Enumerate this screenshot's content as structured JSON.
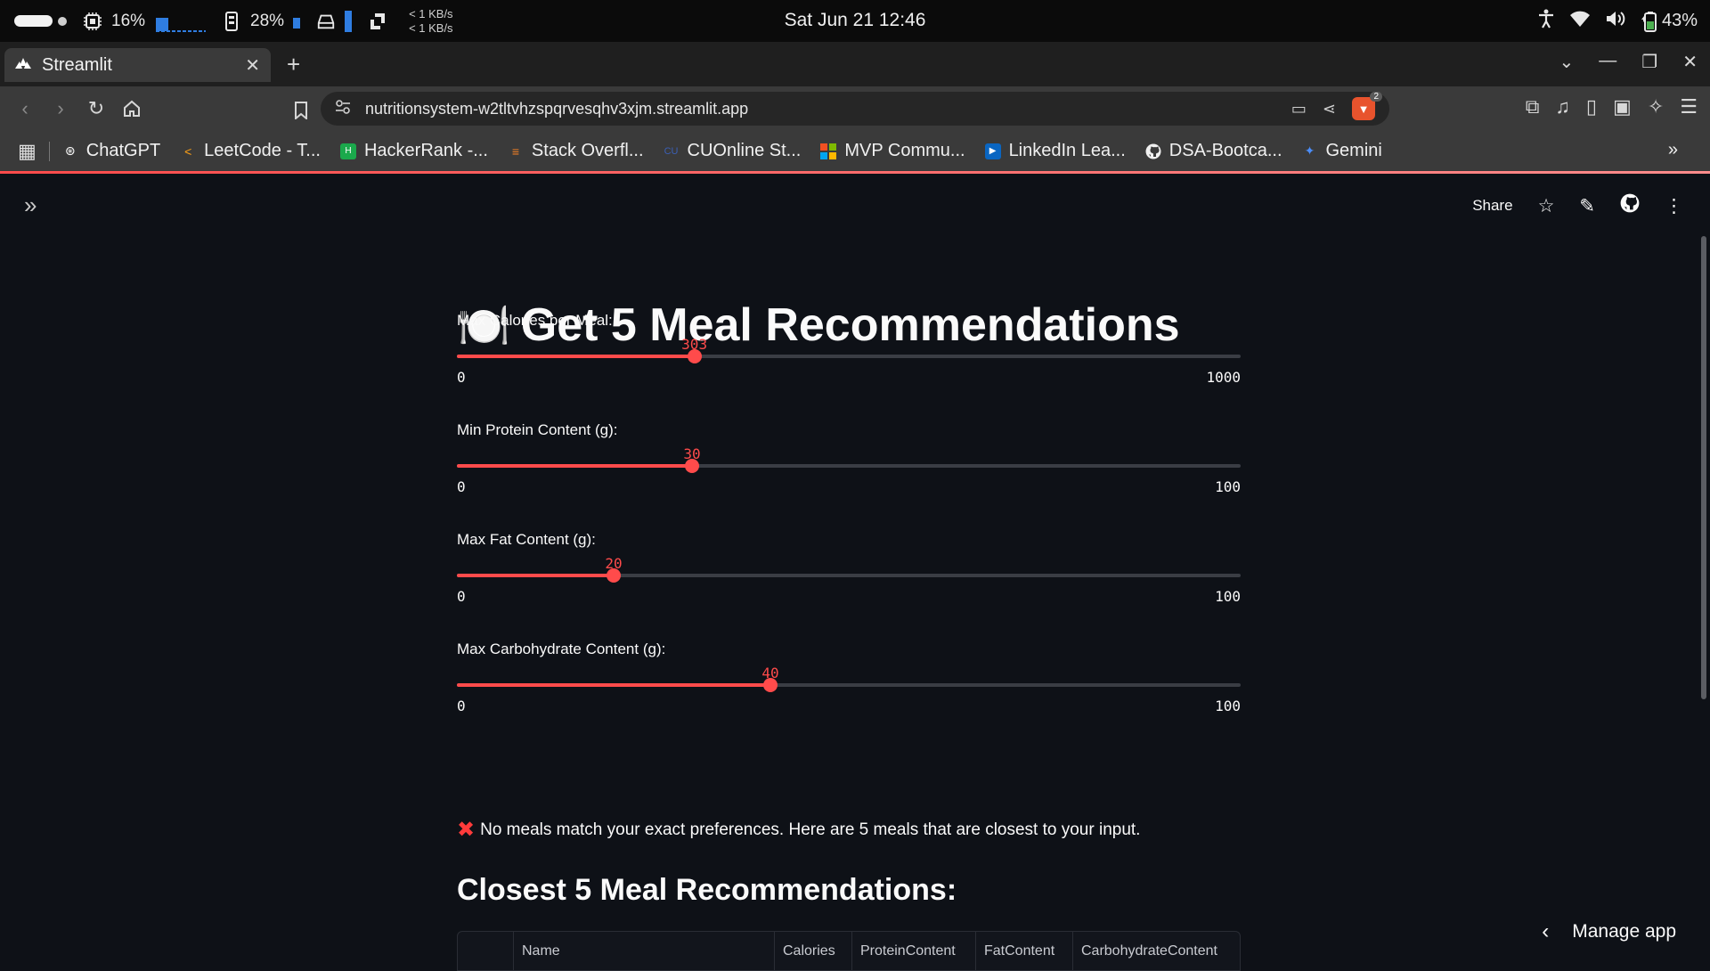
{
  "os": {
    "cpu": "16%",
    "mem": "28%",
    "net_down": "< 1 KB/s",
    "net_up": "< 1 KB/s",
    "clock": "Sat Jun 21  12:46",
    "battery": "43%",
    "icons": [
      "cpu-icon",
      "memory-icon",
      "disk-icon",
      "network-icon",
      "accessibility-icon",
      "wifi-icon",
      "volume-icon",
      "battery-icon"
    ]
  },
  "browser": {
    "tab_title": "Streamlit",
    "url": "nutritionsystem-w2tltvhzspqrvesqhv3xjm.streamlit.app",
    "brave_badge": "2",
    "bookmarks": [
      {
        "label": "ChatGPT",
        "icon": "chatgpt-icon"
      },
      {
        "label": "LeetCode - T...",
        "icon": "leetcode-icon"
      },
      {
        "label": "HackerRank -...",
        "icon": "hackerrank-icon"
      },
      {
        "label": "Stack Overfl...",
        "icon": "stackoverflow-icon"
      },
      {
        "label": "CUOnline St...",
        "icon": "cuonline-icon"
      },
      {
        "label": "MVP Commu...",
        "icon": "microsoft-icon"
      },
      {
        "label": "LinkedIn Lea...",
        "icon": "linkedin-learning-icon"
      },
      {
        "label": "DSA-Bootca...",
        "icon": "github-icon"
      },
      {
        "label": "Gemini",
        "icon": "gemini-icon"
      }
    ]
  },
  "app": {
    "share_label": "Share",
    "title": "Get 5 Meal Recommendations",
    "title_emoji": "🍽️",
    "sliders": [
      {
        "label": "Max Calories per Meal:",
        "value": 303,
        "min": 0,
        "max": 1000
      },
      {
        "label": "Min Protein Content (g):",
        "value": 30,
        "min": 0,
        "max": 100
      },
      {
        "label": "Max Fat Content (g):",
        "value": 20,
        "min": 0,
        "max": 100
      },
      {
        "label": "Max Carbohydrate Content (g):",
        "value": 40,
        "min": 0,
        "max": 100
      }
    ],
    "warning": "No meals match your exact preferences. Here are 5 meals that are closest to your input.",
    "subheading": "Closest 5 Meal Recommendations:",
    "table_headers": [
      "",
      "Name",
      "Calories",
      "ProteinContent",
      "FatContent",
      "CarbohydrateContent"
    ],
    "manage_app": "Manage app",
    "accent_color": "#ff4b4b"
  }
}
